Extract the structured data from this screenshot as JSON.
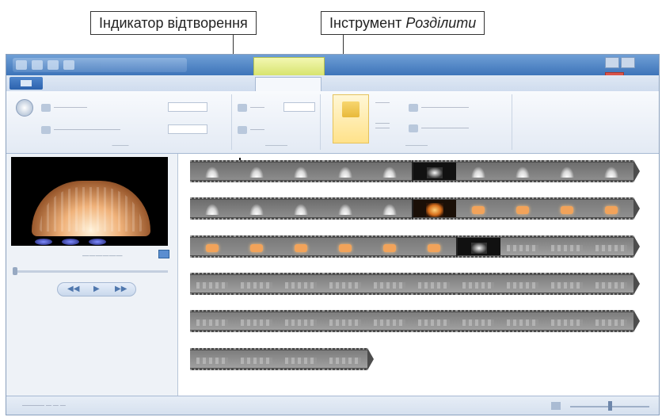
{
  "callouts": {
    "playback_indicator": "Індикатор відтворення",
    "split_tool_prefix": "Інструмент",
    "split_tool_name": "Розділити"
  },
  "window": {
    "title_bar": {
      "quick_access_icons": [
        "save-icon",
        "undo-icon",
        "redo-icon",
        "dropdown-icon"
      ]
    },
    "ribbon": {
      "active_tab_index": 7,
      "split_button_icon": "split-icon",
      "split_highlight_color": "#ffe28a"
    }
  },
  "preview": {
    "controls": {
      "previous_icon": "◀◀",
      "play_icon": "▶",
      "next_icon": "▶▶"
    }
  },
  "storyboard": {
    "rows": [
      [
        "white",
        "white",
        "white",
        "white",
        "white",
        "sep-dark",
        "white",
        "white",
        "white",
        "white"
      ],
      [
        "white",
        "white",
        "white",
        "white",
        "white",
        "sep-fire",
        "orange",
        "orange",
        "orange",
        "orange"
      ],
      [
        "orange",
        "orange",
        "orange",
        "orange",
        "orange",
        "orange",
        "sep-dark",
        "gray",
        "gray",
        "gray"
      ],
      [
        "gray",
        "gray",
        "gray",
        "gray",
        "gray",
        "gray",
        "gray",
        "gray",
        "gray",
        "gray"
      ],
      [
        "gray",
        "gray",
        "gray",
        "gray",
        "gray",
        "gray",
        "gray",
        "gray",
        "gray",
        "gray"
      ],
      [
        "gray",
        "gray",
        "gray",
        "gray"
      ]
    ]
  }
}
